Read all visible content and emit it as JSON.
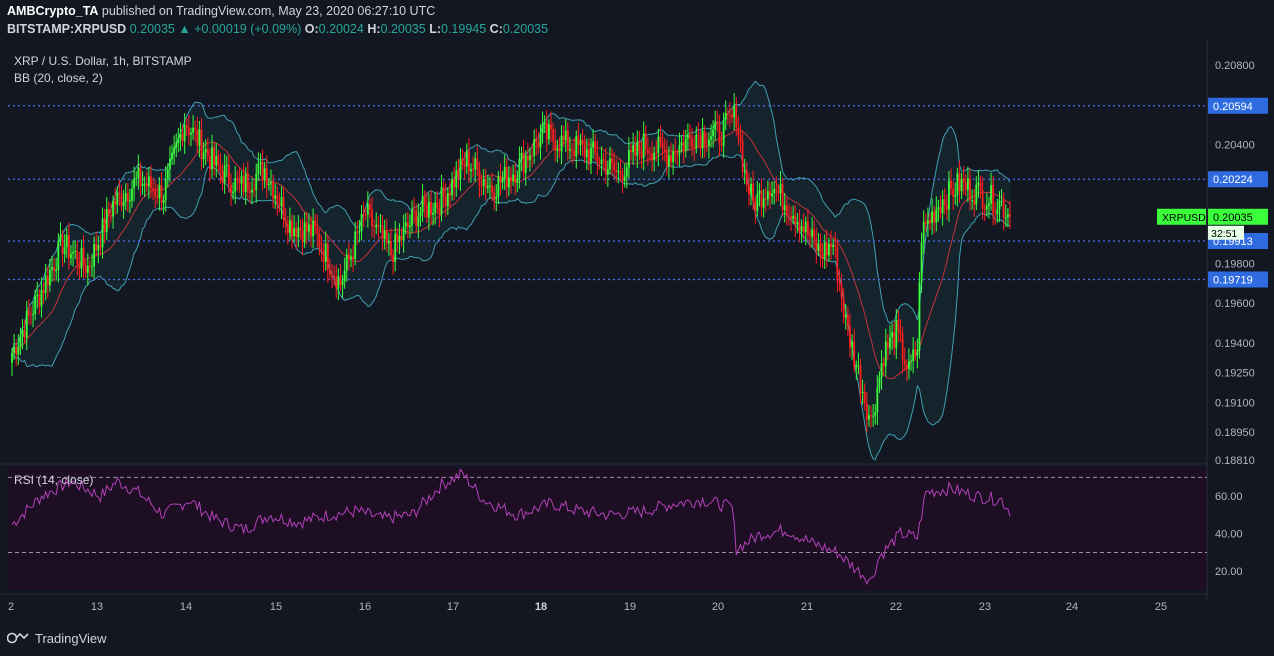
{
  "header": {
    "author": "AMBCrypto_TA",
    "published_text": "published on TradingView.com, May 23, 2020 06:27:10 UTC",
    "symbol": "BITSTAMP:XRPUSD",
    "last": "0.20035",
    "change": "+0.00019 (+0.09%)",
    "o_label": "O:",
    "o_value": "0.20024",
    "h_label": "H:",
    "h_value": "0.20035",
    "l_label": "L:",
    "l_value": "0.19945",
    "c_label": "C:",
    "c_value": "0.20035"
  },
  "footer": {
    "brand": "TradingView",
    "logo_icon": "tradingview-logo-icon"
  },
  "colors": {
    "bg": "#131722",
    "up": "#3bff3b",
    "down": "#ff1f1f",
    "bb_band": "#3f9fb1",
    "bb_basis": "#c4333d",
    "level_line": "#4d6ef0",
    "rsi": "#b142b7",
    "rsi_bg": "#1d0e24",
    "price_badge": "#3bff3b",
    "level_badge": "#2f6be0"
  },
  "chart_data": [
    {
      "type": "candlestick",
      "title": "XRP / U.S. Dollar, 1h, BITSTAMP",
      "indicator_label": "BB (20, close, 2)",
      "ylim": [
        0.1881,
        0.209
      ],
      "y_ticks": [
        "0.20800",
        "0.20400",
        "0.19800",
        "0.19600",
        "0.19400",
        "0.19250",
        "0.19100",
        "0.18950",
        "0.18810"
      ],
      "x_ticks": [
        "2",
        "13",
        "14",
        "15",
        "16",
        "17",
        "18",
        "19",
        "20",
        "21",
        "22",
        "23",
        "24",
        "25"
      ],
      "horizontal_levels": [
        "0.20594",
        "0.20224",
        "0.19913",
        "0.19719"
      ],
      "last_price_label": "XRPUSD",
      "last_price": "0.20035",
      "countdown": "32:51",
      "anchors": [
        [
          0,
          0.1935
        ],
        [
          12,
          0.1962
        ],
        [
          24,
          0.199
        ],
        [
          36,
          0.1978
        ],
        [
          48,
          0.201
        ],
        [
          60,
          0.2022
        ],
        [
          72,
          0.2015
        ],
        [
          82,
          0.2052
        ],
        [
          96,
          0.203
        ],
        [
          108,
          0.2018
        ],
        [
          120,
          0.2028
        ],
        [
          132,
          0.2
        ],
        [
          144,
          0.1995
        ],
        [
          156,
          0.197
        ],
        [
          168,
          0.2005
        ],
        [
          180,
          0.1985
        ],
        [
          192,
          0.2005
        ],
        [
          204,
          0.2012
        ],
        [
          216,
          0.2032
        ],
        [
          228,
          0.2018
        ],
        [
          240,
          0.2028
        ],
        [
          252,
          0.2045
        ],
        [
          264,
          0.204
        ],
        [
          276,
          0.2035
        ],
        [
          288,
          0.2025
        ],
        [
          300,
          0.204
        ],
        [
          312,
          0.2035
        ],
        [
          324,
          0.2045
        ],
        [
          336,
          0.2045
        ],
        [
          344,
          0.2055
        ],
        [
          348,
          0.2025
        ],
        [
          352,
          0.201
        ],
        [
          360,
          0.202
        ],
        [
          372,
          0.2005
        ],
        [
          384,
          0.1985
        ],
        [
          390,
          0.199
        ],
        [
          396,
          0.195
        ],
        [
          402,
          0.1925
        ],
        [
          408,
          0.19
        ],
        [
          414,
          0.1935
        ],
        [
          420,
          0.1945
        ],
        [
          426,
          0.1925
        ],
        [
          430,
          0.1938
        ],
        [
          432,
          0.1995
        ],
        [
          440,
          0.201
        ],
        [
          450,
          0.202
        ],
        [
          460,
          0.2015
        ],
        [
          470,
          0.201
        ],
        [
          474,
          0.20035
        ]
      ]
    },
    {
      "type": "line",
      "title": "RSI (14, close)",
      "ylim": [
        10,
        75
      ],
      "y_ticks": [
        "60.00",
        "40.00",
        "20.00"
      ],
      "levels": [
        70,
        30
      ],
      "anchors": [
        [
          0,
          45
        ],
        [
          14,
          60
        ],
        [
          28,
          68
        ],
        [
          42,
          60
        ],
        [
          50,
          68
        ],
        [
          60,
          62
        ],
        [
          72,
          50
        ],
        [
          84,
          58
        ],
        [
          96,
          48
        ],
        [
          110,
          42
        ],
        [
          122,
          50
        ],
        [
          136,
          46
        ],
        [
          150,
          50
        ],
        [
          164,
          52
        ],
        [
          176,
          48
        ],
        [
          190,
          50
        ],
        [
          204,
          66
        ],
        [
          214,
          72
        ],
        [
          224,
          58
        ],
        [
          240,
          50
        ],
        [
          256,
          56
        ],
        [
          270,
          52
        ],
        [
          284,
          50
        ],
        [
          300,
          52
        ],
        [
          314,
          56
        ],
        [
          328,
          58
        ],
        [
          342,
          54
        ],
        [
          344,
          32
        ],
        [
          356,
          40
        ],
        [
          368,
          42
        ],
        [
          380,
          35
        ],
        [
          392,
          30
        ],
        [
          400,
          22
        ],
        [
          408,
          15
        ],
        [
          412,
          28
        ],
        [
          422,
          40
        ],
        [
          430,
          38
        ],
        [
          434,
          62
        ],
        [
          446,
          64
        ],
        [
          458,
          60
        ],
        [
          470,
          58
        ],
        [
          474,
          52
        ]
      ]
    }
  ]
}
